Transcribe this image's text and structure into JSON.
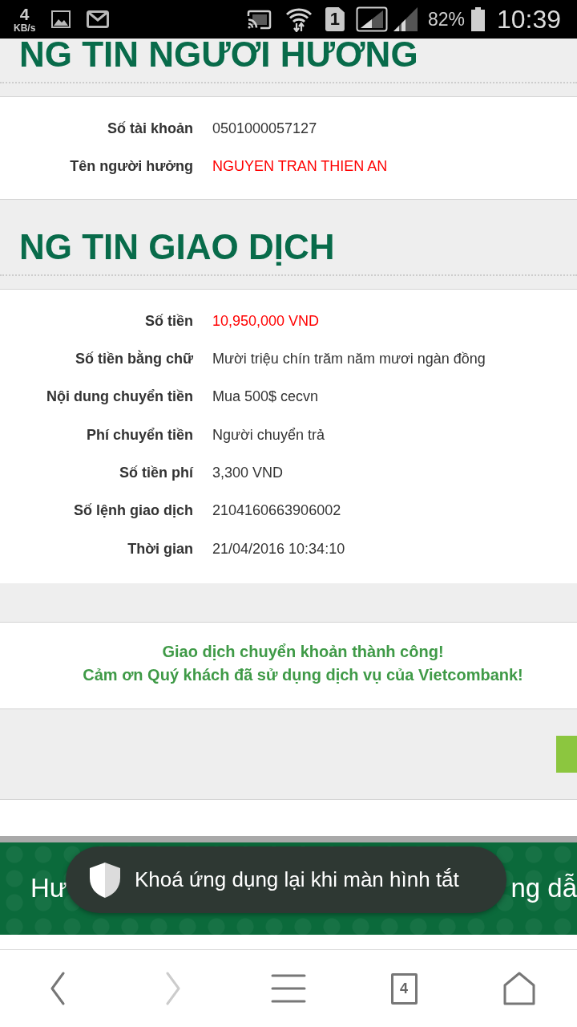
{
  "status_bar": {
    "speed": "4",
    "speed_unit": "KB/s",
    "sim": "1",
    "battery": "82%",
    "time": "10:39"
  },
  "sections": [
    {
      "title": "NG TIN NGƯƠI HƯƠNG",
      "rows": [
        {
          "label": "Số tài khoản",
          "value": "0501000057127",
          "highlighted": false
        },
        {
          "label": "Tên người hưởng",
          "value": "NGUYEN TRAN THIEN AN",
          "highlighted": true
        }
      ]
    },
    {
      "title": "NG TIN GIAO DỊCH",
      "rows": [
        {
          "label": "Số tiền",
          "value": "10,950,000 VND",
          "highlighted": true
        },
        {
          "label": "Số tiền bằng chữ",
          "value": "Mười triệu chín trăm năm mươi ngàn đồng",
          "highlighted": false
        },
        {
          "label": "Nội dung chuyển tiền",
          "value": "Mua 500$ cecvn",
          "highlighted": false
        },
        {
          "label": "Phí chuyển tiền",
          "value": "Người chuyển trả",
          "highlighted": false
        },
        {
          "label": "Số tiền phí",
          "value": "3,300 VND",
          "highlighted": false
        },
        {
          "label": "Số lệnh giao dịch",
          "value": "2104160663906002",
          "highlighted": false
        },
        {
          "label": "Thời gian",
          "value": "21/04/2016 10:34:10",
          "highlighted": false
        }
      ]
    }
  ],
  "result": {
    "lines": [
      "Giao dịch chuyển khoản thành công!",
      "Cảm ơn Quý khách đã sử dụng dịch vụ của Vietcombank!"
    ]
  },
  "footer_banner": {
    "text_start": "Hư",
    "text_end": "ng dẫ"
  },
  "toast": {
    "text": "Khoá ứng dụng lại khi màn hình tắt"
  },
  "browser_nav": [
    {
      "kind": "back",
      "disabled": false
    },
    {
      "kind": "forward",
      "disabled": true
    },
    {
      "kind": "menu",
      "disabled": false
    },
    {
      "kind": "tabs",
      "count": "4",
      "disabled": false
    },
    {
      "kind": "home",
      "disabled": false
    }
  ]
}
